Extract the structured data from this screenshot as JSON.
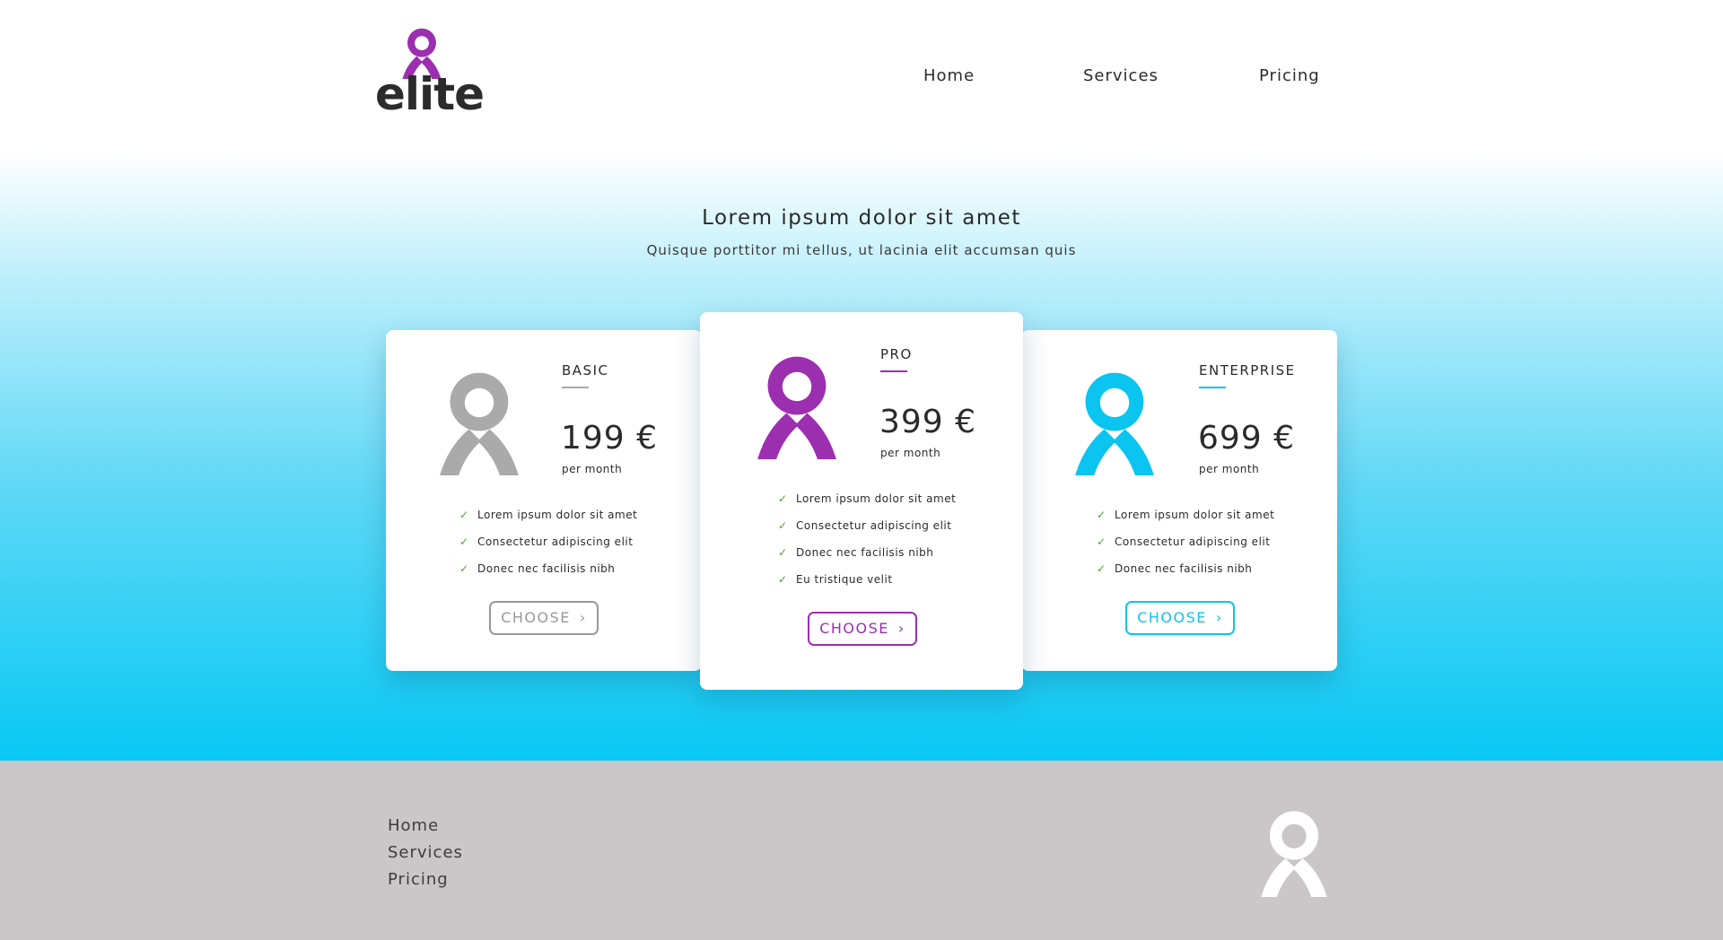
{
  "brand": {
    "wordmark": "elite",
    "colors": {
      "purple": "#9b2fb0",
      "cyan": "#0bc4f0",
      "gray": "#aaaaaa",
      "check": "#4fa03a"
    }
  },
  "nav": {
    "items": [
      "Home",
      "Services",
      "Pricing"
    ]
  },
  "hero": {
    "title": "Lorem ipsum dolor sit amet",
    "subtitle": "Quisque porttitor mi tellus, ut lacinia elit accumsan quis"
  },
  "plans": [
    {
      "name": "BASIC",
      "price": "199 €",
      "period": "per month",
      "features": [
        "Lorem ipsum dolor sit amet",
        "Consectetur adipiscing elit",
        "Donec nec facilisis nibh"
      ],
      "button": "CHOOSE",
      "accent": "#aaaaaa"
    },
    {
      "name": "PRO",
      "price": "399 €",
      "period": "per month",
      "features": [
        "Lorem ipsum dolor sit amet",
        "Consectetur adipiscing elit",
        "Donec nec facilisis nibh",
        "Eu tristique velit"
      ],
      "button": "CHOOSE",
      "accent": "#9b2fb0"
    },
    {
      "name": "ENTERPRISE",
      "price": "699 €",
      "period": "per month",
      "features": [
        "Lorem ipsum dolor sit amet",
        "Consectetur adipiscing elit",
        "Donec nec facilisis nibh"
      ],
      "button": "CHOOSE",
      "accent": "#0bc4f0"
    }
  ],
  "footer": {
    "links": [
      "Home",
      "Services",
      "Pricing"
    ]
  },
  "icons": {
    "logo": "ribbon-logo-icon",
    "check": "check-icon",
    "chevron": "chevron-right-icon"
  }
}
